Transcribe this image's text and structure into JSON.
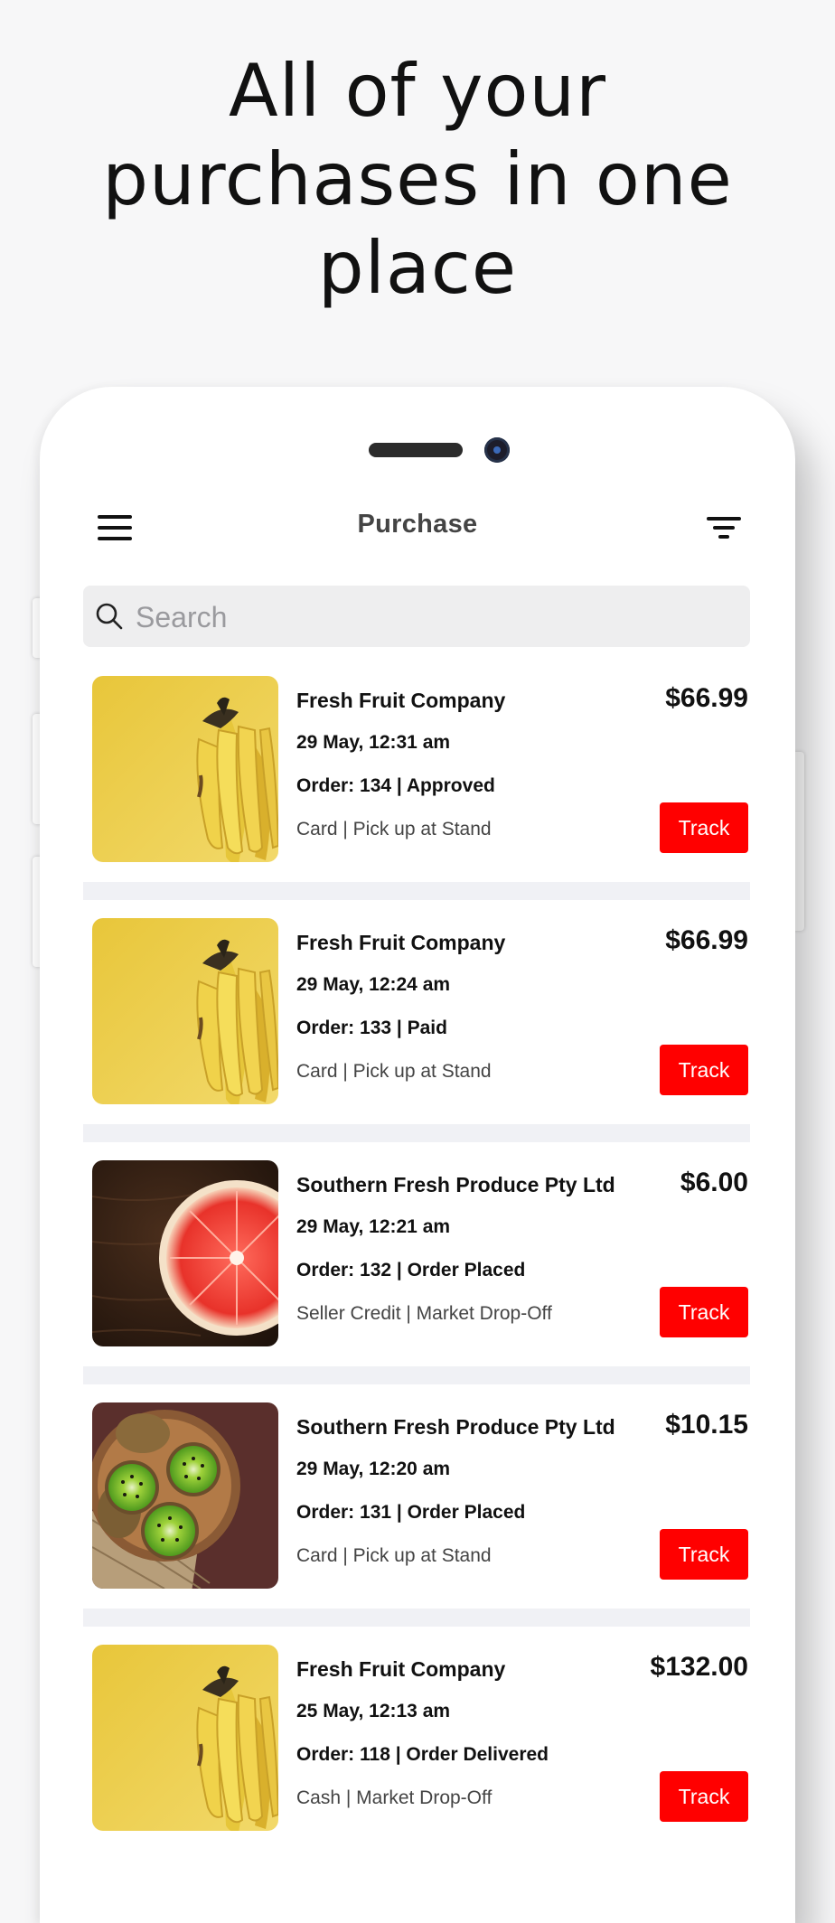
{
  "headline": {
    "line1": "All of your",
    "line2": "purchases in one",
    "line3": "place"
  },
  "nav": {
    "title": "Purchase",
    "menu_icon": "hamburger-menu-icon",
    "filter_icon": "filter-icon"
  },
  "search": {
    "placeholder": "Search",
    "icon": "search-icon"
  },
  "colors": {
    "accent": "#ff0000",
    "background": "#f7f7f8",
    "separator": "#f0f1f5"
  },
  "purchases": [
    {
      "company": "Fresh Fruit Company",
      "date": "29 May, 12:31 am",
      "order": "Order: 134 | Approved",
      "payment": "Card | Pick up at Stand",
      "price": "$66.99",
      "track_label": "Track",
      "image": "bananas"
    },
    {
      "company": "Fresh Fruit Company",
      "date": "29 May, 12:24 am",
      "order": "Order: 133 | Paid",
      "payment": "Card | Pick up at Stand",
      "price": "$66.99",
      "track_label": "Track",
      "image": "bananas"
    },
    {
      "company": "Southern Fresh Produce Pty Ltd",
      "date": "29 May, 12:21 am",
      "order": "Order: 132 | Order Placed",
      "payment": "Seller Credit | Market Drop-Off",
      "price": "$6.00",
      "track_label": "Track",
      "image": "grapefruit"
    },
    {
      "company": "Southern Fresh Produce Pty Ltd",
      "date": "29 May, 12:20 am",
      "order": "Order: 131 | Order Placed",
      "payment": "Card | Pick up at Stand",
      "price": "$10.15",
      "track_label": "Track",
      "image": "kiwi"
    },
    {
      "company": "Fresh Fruit Company",
      "date": "25 May, 12:13 am",
      "order": "Order: 118 | Order Delivered",
      "payment": "Cash | Market Drop-Off",
      "price": "$132.00",
      "track_label": "Track",
      "image": "bananas"
    }
  ]
}
